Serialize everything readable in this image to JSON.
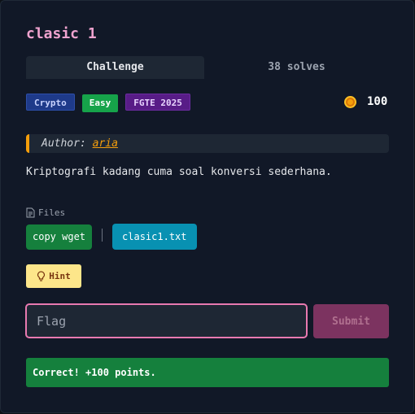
{
  "challenge": {
    "title": "clasic 1",
    "tabs": {
      "challenge": "Challenge",
      "solves": "38 solves"
    },
    "badges": {
      "category": "Crypto",
      "difficulty": "Easy",
      "event": "FGTE 2025"
    },
    "points": "100",
    "author_prefix": "Author:",
    "author_name": "aria",
    "description": "Kriptografi kadang cuma soal konversi sederhana.",
    "files_label": "Files",
    "copy_wget_label": "copy wget",
    "file_name": "clasic1.txt",
    "hint_label": "Hint",
    "flag_placeholder": "Flag",
    "submit_label": "Submit",
    "result_message": "Correct! +100 points."
  },
  "colors": {
    "title": "#f0a3cf",
    "accent_pink": "#e879b0",
    "success_green": "#15803d",
    "file_blue": "#0891b2",
    "coin": "#f59e0b"
  },
  "icons": {
    "points": "coin-icon",
    "files": "file-icon",
    "hint": "lightbulb-icon"
  }
}
